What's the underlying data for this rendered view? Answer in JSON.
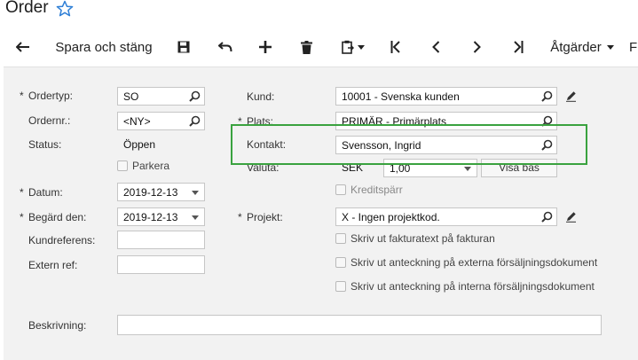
{
  "window": {
    "title": "Order"
  },
  "toolbar": {
    "save_close_label": "Spara och stäng",
    "actions_label": "Åtgärder",
    "overflow_label": "F"
  },
  "form": {
    "ordertyp": {
      "label": "Ordertyp:",
      "value": "SO"
    },
    "ordernr": {
      "label": "Ordernr.:",
      "value": "<NY>"
    },
    "status": {
      "label": "Status:",
      "value": "Öppen"
    },
    "parkera": {
      "label": "Parkera"
    },
    "datum": {
      "label": "Datum:",
      "value": "2019-12-13"
    },
    "begard_den": {
      "label": "Begärd den:",
      "value": "2019-12-13"
    },
    "kundreferens": {
      "label": "Kundreferens:",
      "value": ""
    },
    "extern_ref": {
      "label": "Extern ref:",
      "value": ""
    },
    "kund": {
      "label": "Kund:",
      "value": "10001 - Svenska kunden"
    },
    "plats": {
      "label": "Plats:",
      "value": "PRIMÄR - Primärplats"
    },
    "kontakt": {
      "label": "Kontakt:",
      "value": "Svensson, Ingrid"
    },
    "valuta": {
      "label": "Valuta:",
      "currency": "SEK",
      "rate": "1,00",
      "button": "Visa bas"
    },
    "kreditsparr": {
      "label": "Kreditspärr"
    },
    "projekt": {
      "label": "Projekt:",
      "value": "X - Ingen projektkod."
    },
    "checkboxes": [
      "Skriv ut fakturatext på fakturan",
      "Skriv ut anteckning på externa försäljningsdokument",
      "Skriv ut anteckning på interna försäljningsdokument"
    ],
    "beskrivning": {
      "label": "Beskrivning:",
      "value": ""
    },
    "required_marker": "*"
  },
  "colors": {
    "highlight": "#3aa23f",
    "star": "#2f7fd6",
    "background": "#f2f2f2"
  }
}
